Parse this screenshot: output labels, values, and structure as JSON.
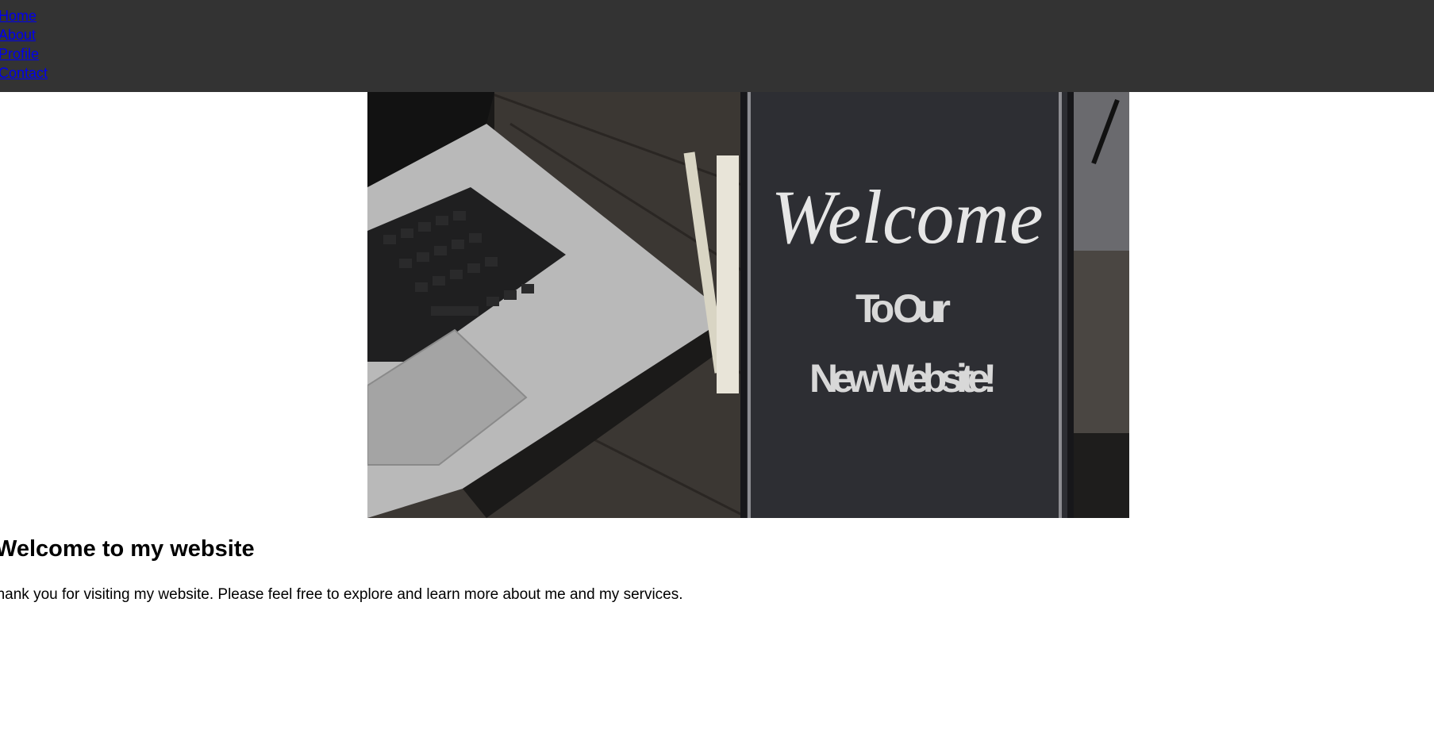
{
  "nav": {
    "items": [
      {
        "label": "Home"
      },
      {
        "label": "About"
      },
      {
        "label": "Profile"
      },
      {
        "label": "Contact"
      }
    ]
  },
  "hero": {
    "sign_welcome": "Welcome",
    "sign_line1": "To Our",
    "sign_line2": "New Website!"
  },
  "main": {
    "heading": "Welcome to my website",
    "intro": "Thank you for visiting my website. Please feel free to explore and learn more about me and my services."
  },
  "colors": {
    "navbar_bg": "#333333",
    "link": "#0000ee",
    "sign_panel": "#2d2e33"
  }
}
